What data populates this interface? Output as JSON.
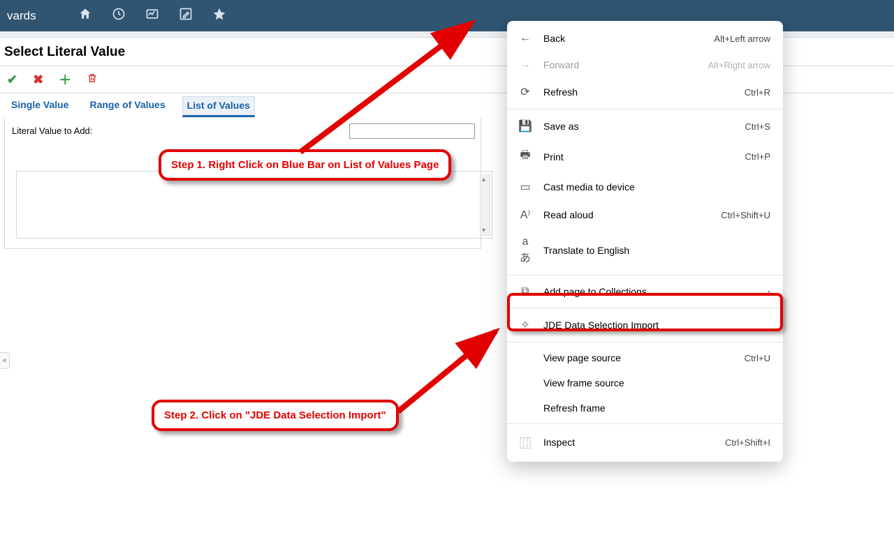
{
  "topbar": {
    "title_fragment": "vards",
    "icons": [
      "home-icon",
      "clock-icon",
      "chart-icon",
      "edit-icon",
      "star-icon"
    ]
  },
  "page": {
    "title": "Select Literal Value",
    "toolbar": {
      "check_title": "OK",
      "x_title": "Cancel",
      "plus_title": "Add",
      "trash_title": "Delete"
    },
    "tabs": {
      "single": "Single Value",
      "range": "Range of Values",
      "list": "List of Values"
    },
    "form": {
      "literal_label": "Literal Value to Add:",
      "literal_value": ""
    }
  },
  "ctx": {
    "back": {
      "label": "Back",
      "shortcut": "Alt+Left arrow"
    },
    "forward": {
      "label": "Forward",
      "shortcut": "Alt+Right arrow"
    },
    "refresh": {
      "label": "Refresh",
      "shortcut": "Ctrl+R"
    },
    "saveas": {
      "label": "Save as",
      "shortcut": "Ctrl+S"
    },
    "print": {
      "label": "Print",
      "shortcut": "Ctrl+P"
    },
    "cast": {
      "label": "Cast media to device"
    },
    "readaloud": {
      "label": "Read aloud",
      "shortcut": "Ctrl+Shift+U"
    },
    "translate": {
      "label": "Translate to English"
    },
    "collections": {
      "label": "Add page to Collections"
    },
    "ext": {
      "label": "JDE Data Selection Import"
    },
    "viewsource": {
      "label": "View page source",
      "shortcut": "Ctrl+U"
    },
    "viewframe": {
      "label": "View frame source"
    },
    "refreshframe": {
      "label": "Refresh frame"
    },
    "inspect": {
      "label": "Inspect",
      "shortcut": "Ctrl+Shift+I"
    }
  },
  "annotations": {
    "step1": "Step 1. Right Click on Blue Bar on List of Values Page",
    "step2": "Step 2. Click on \"JDE Data Selection Import\""
  }
}
